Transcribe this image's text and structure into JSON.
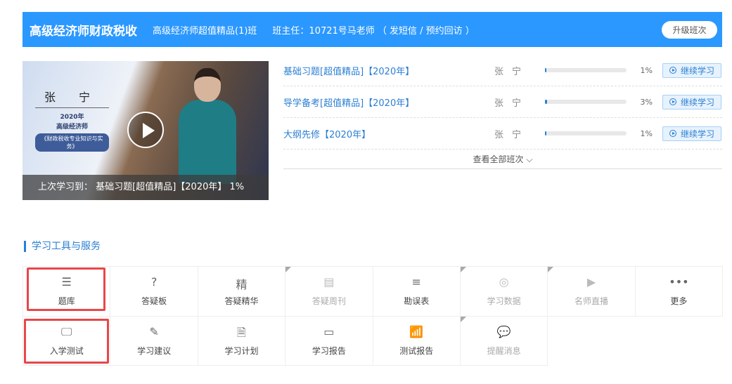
{
  "header": {
    "title": "高级经济师财政税收",
    "class_name": "高级经济师超值精品(1)班",
    "teacher_info": "班主任：10721号马老师 （ 发短信 / 预约回访 ）",
    "upgrade_label": "升级班次"
  },
  "video": {
    "card_name": "张 宁",
    "card_year": "2020年",
    "card_level": "高级经济师",
    "card_book": "《财政税收专业知识与实务》",
    "last_study": "上次学习到： 基础习题[超值精品]【2020年】 1%"
  },
  "courses": [
    {
      "name": "基础习题[超值精品]【2020年】",
      "teacher": "张宁",
      "progress": 1,
      "progress_label": "1%",
      "action": "继续学习"
    },
    {
      "name": "导学备考[超值精品]【2020年】",
      "teacher": "张宁",
      "progress": 3,
      "progress_label": "3%",
      "action": "继续学习"
    },
    {
      "name": "大纲先修【2020年】",
      "teacher": "张宁",
      "progress": 1,
      "progress_label": "1%",
      "action": "继续学习"
    }
  ],
  "view_all": "查看全部班次 ⌵",
  "section_title": "学习工具与服务",
  "tools": [
    {
      "label": "题库",
      "icon": "☰",
      "disabled": false
    },
    {
      "label": "答疑板",
      "icon": "?",
      "disabled": false
    },
    {
      "label": "答疑精华",
      "icon": "精",
      "disabled": false
    },
    {
      "label": "答疑周刊",
      "icon": "▤",
      "disabled": true
    },
    {
      "label": "勘误表",
      "icon": "≡",
      "disabled": false
    },
    {
      "label": "学习数据",
      "icon": "◎",
      "disabled": true
    },
    {
      "label": "名师直播",
      "icon": "▶",
      "disabled": true
    },
    {
      "label": "更多",
      "icon": "•••",
      "disabled": false
    },
    {
      "label": "入学测试",
      "icon": "🖵",
      "disabled": false
    },
    {
      "label": "学习建议",
      "icon": "✎",
      "disabled": false
    },
    {
      "label": "学习计划",
      "icon": "🗎",
      "disabled": false
    },
    {
      "label": "学习报告",
      "icon": "▭",
      "disabled": false
    },
    {
      "label": "测试报告",
      "icon": "📶",
      "disabled": false
    },
    {
      "label": "提醒消息",
      "icon": "💬",
      "disabled": true
    }
  ]
}
